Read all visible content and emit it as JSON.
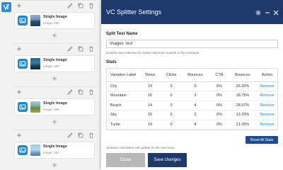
{
  "builder": {
    "elements": [
      {
        "title": "Single Image",
        "subtitle": "Image: 290"
      },
      {
        "title": "Single Image",
        "subtitle": "Image: 289"
      },
      {
        "title": "Single Image",
        "subtitle": "Image: 288"
      },
      {
        "title": "Single Image",
        "subtitle": "Image: 287"
      }
    ]
  },
  "modal": {
    "title": "VC Splitter Settings",
    "split_test_name_label": "Split Test Name",
    "split_test_name_value": "Images Test",
    "split_test_hint": "Enables text selection for button elements outside of the container.",
    "stats_label": "Stats",
    "table": {
      "headers": [
        "Variation Label",
        "Views",
        "Clicks",
        "Bounces",
        "CTR",
        "Bounces",
        "Action"
      ],
      "rows": [
        {
          "label": "City",
          "views": "19",
          "clicks": "0",
          "bounces": "5",
          "ctr": "0%",
          "bounce_rate": "26.32%",
          "action": "Remove"
        },
        {
          "label": "Mountain",
          "views": "16",
          "clicks": "0",
          "bounces": "3",
          "ctr": "0%",
          "bounce_rate": "18.75%",
          "action": "Remove"
        },
        {
          "label": "Beach",
          "views": "14",
          "clicks": "0",
          "bounces": "4",
          "ctr": "0%",
          "bounce_rate": "28.57%",
          "action": "Remove"
        },
        {
          "label": "Sky",
          "views": "15",
          "clicks": "0",
          "bounces": "2",
          "ctr": "0%",
          "bounce_rate": "13.33%",
          "action": "Remove"
        },
        {
          "label": "Turtle",
          "views": "19",
          "clicks": "0",
          "bounces": "4",
          "ctr": "0%",
          "bounce_rate": "21.05%",
          "action": "Remove"
        }
      ]
    },
    "reset_button": "Reset All Stats",
    "footnote": "Statistics and labels will update on the next view.",
    "close_button": "Close",
    "save_button": "Save changes"
  },
  "colors": {
    "header": "#1e3a6d",
    "accent": "#1e87d5",
    "reset_button": "#1e4d8f",
    "close_button": "#b8b8b8"
  },
  "icons": {
    "builder_logo": "vc-logo-icon",
    "toolbar": [
      "plus-icon",
      "pencil-icon",
      "copy-icon",
      "trash-icon"
    ],
    "element": "image-element-icon",
    "header": [
      "gear-icon",
      "minimize-icon",
      "close-icon"
    ]
  }
}
